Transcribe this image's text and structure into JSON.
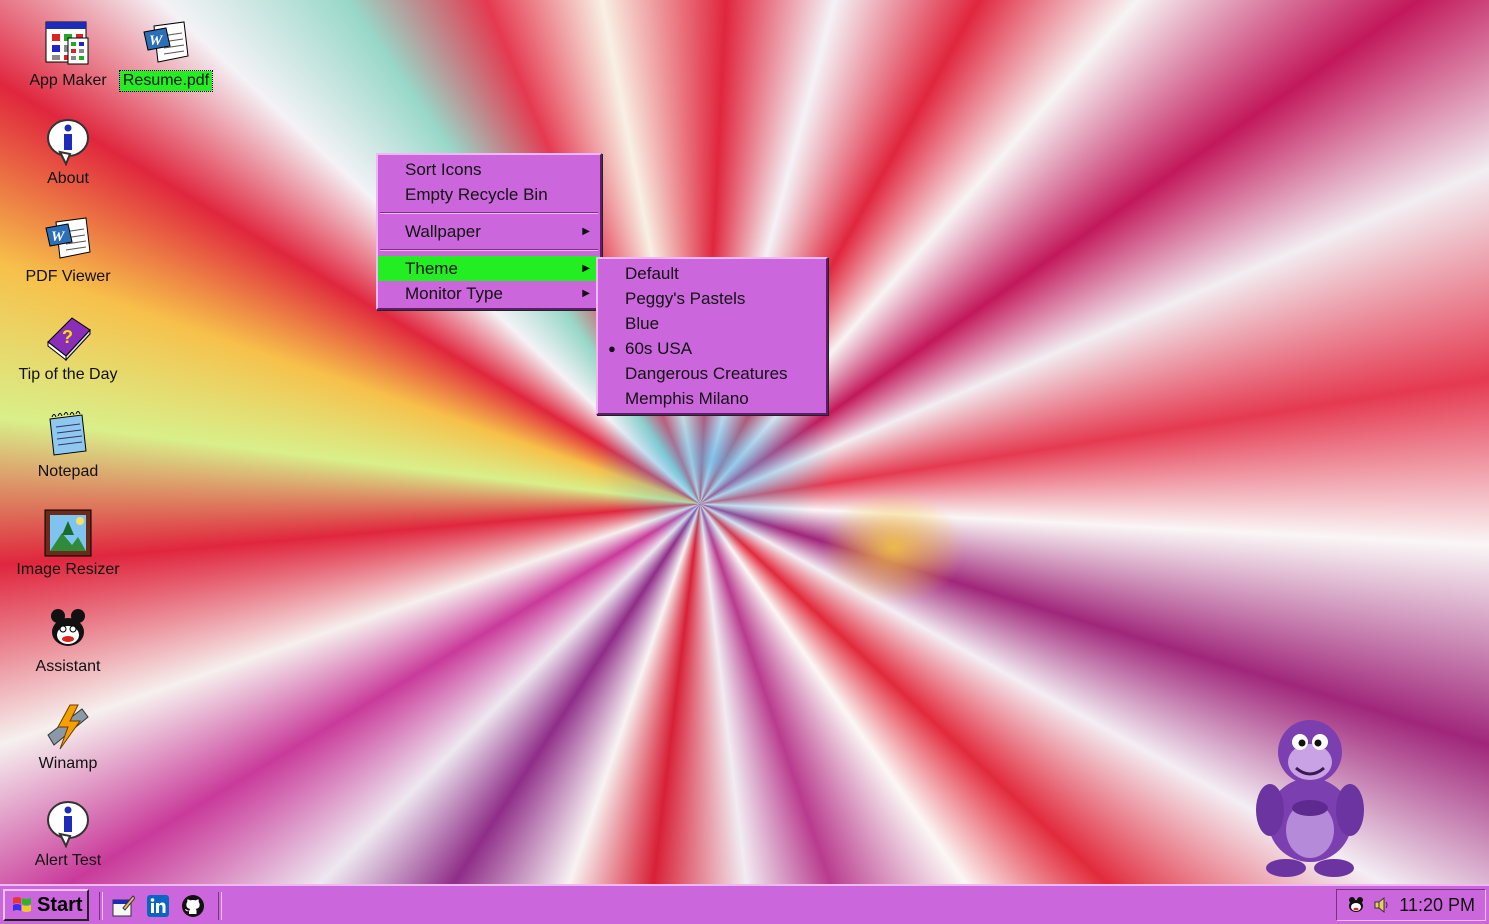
{
  "desktop": {
    "icons": [
      {
        "label": "App Maker",
        "icon": "app-maker-icon"
      },
      {
        "label": "Resume.pdf",
        "icon": "word-document-icon",
        "selected": true
      },
      {
        "label": "About",
        "icon": "info-icon"
      },
      {
        "label": "PDF Viewer",
        "icon": "word-document-icon"
      },
      {
        "label": "Tip of the Day",
        "icon": "help-book-icon"
      },
      {
        "label": "Notepad",
        "icon": "notepad-icon"
      },
      {
        "label": "Image Resizer",
        "icon": "picture-icon"
      },
      {
        "label": "Assistant",
        "icon": "assistant-icon"
      },
      {
        "label": "Winamp",
        "icon": "winamp-icon"
      },
      {
        "label": "Alert Test",
        "icon": "info-icon"
      }
    ]
  },
  "context_menu": {
    "items": {
      "sort_icons": "Sort Icons",
      "empty_recycle_bin": "Empty Recycle Bin",
      "wallpaper": "Wallpaper",
      "theme": "Theme",
      "monitor_type": "Monitor Type"
    },
    "active_item": "Theme"
  },
  "theme_submenu": {
    "items": [
      "Default",
      "Peggy's Pastels",
      "Blue",
      "60s USA",
      "Dangerous Creatures",
      "Memphis Milano"
    ],
    "selected": "60s USA"
  },
  "taskbar": {
    "start_label": "Start",
    "quick_launch": [
      "desktop-shortcut-icon",
      "linkedin-icon",
      "github-icon"
    ],
    "tray_icons": [
      "assistant-tray-icon",
      "volume-icon"
    ],
    "clock": "11:20 PM"
  },
  "colors": {
    "menu_bg": "#cc66dd",
    "highlight": "#22ee22",
    "taskbar_bg": "#cc66dd"
  }
}
